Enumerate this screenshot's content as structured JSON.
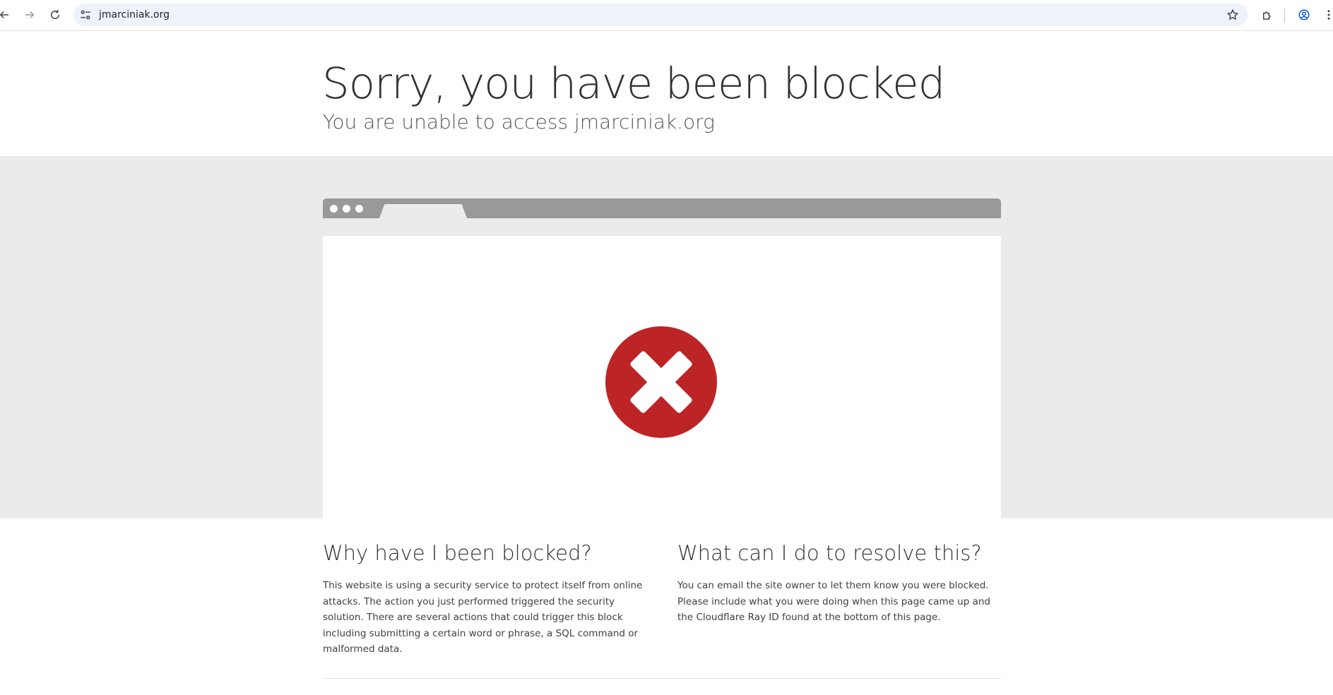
{
  "browser": {
    "url": "jmarciniak.org",
    "icons": [
      "back-icon",
      "forward-icon",
      "reload-icon",
      "site-info-icon",
      "bookmark-star-icon",
      "extensions-icon",
      "profile-icon",
      "menu-icon"
    ]
  },
  "page": {
    "title": "Sorry, you have been blocked",
    "subtitle": "You are unable to access jmarciniak.org",
    "status_icon": "blocked-x-icon",
    "status_color": "#bd2426",
    "why": {
      "heading": "Why have I been blocked?",
      "body": "This website is using a security service to protect itself from online attacks. The action you just performed triggered the security solution. There are several actions that could trigger this block including submitting a certain word or phrase, a SQL command or malformed data."
    },
    "resolve": {
      "heading": "What can I do to resolve this?",
      "body": "You can email the site owner to let them know you were blocked. Please include what you were doing when this page came up and the Cloudflare Ray ID found at the bottom of this page."
    }
  }
}
